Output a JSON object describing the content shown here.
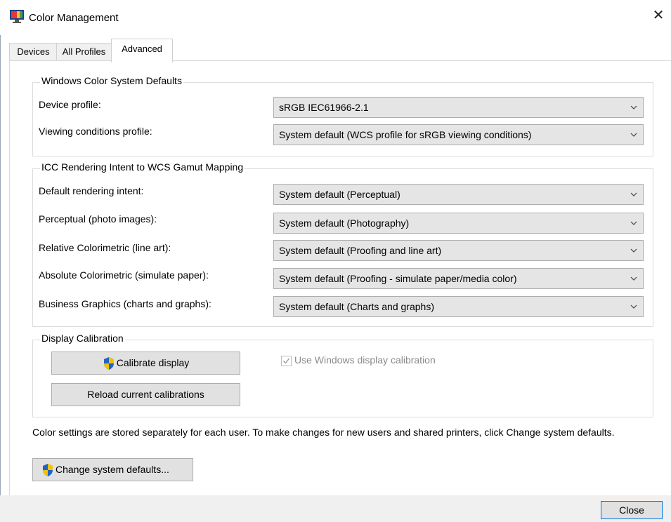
{
  "window": {
    "title": "Color Management",
    "close_glyph": "✕"
  },
  "tabs": [
    {
      "label": "Devices",
      "active": false
    },
    {
      "label": "All Profiles",
      "active": false
    },
    {
      "label": "Advanced",
      "active": true
    }
  ],
  "wcs_defaults": {
    "legend": "Windows Color System Defaults",
    "device_profile": {
      "label": "Device profile:",
      "value": "sRGB IEC61966-2.1"
    },
    "viewing_conditions": {
      "label": "Viewing conditions profile:",
      "value": "System default (WCS profile for sRGB viewing conditions)"
    }
  },
  "gamut_mapping": {
    "legend": "ICC Rendering Intent to WCS Gamut Mapping",
    "rows": [
      {
        "label": "Default rendering intent:",
        "value": "System default (Perceptual)"
      },
      {
        "label": "Perceptual (photo images):",
        "value": "System default (Photography)"
      },
      {
        "label": "Relative Colorimetric (line art):",
        "value": "System default (Proofing and line art)"
      },
      {
        "label": "Absolute Colorimetric (simulate paper):",
        "value": "System default (Proofing - simulate paper/media color)"
      },
      {
        "label": "Business Graphics (charts and graphs):",
        "value": "System default (Charts and graphs)"
      }
    ]
  },
  "calibration": {
    "legend": "Display Calibration",
    "calibrate_button": "Calibrate display",
    "reload_button": "Reload current calibrations",
    "use_windows_calibration": {
      "label": "Use Windows display calibration",
      "checked": true,
      "enabled": false
    }
  },
  "note": "Color settings are stored separately for each user. To make changes for new users and shared printers, click Change system defaults.",
  "change_defaults_button": "Change system defaults...",
  "close_button": "Close",
  "icons": {
    "app": "color-management-icon",
    "shield": "uac-shield-icon",
    "dropdown": "chevron-down-icon"
  }
}
